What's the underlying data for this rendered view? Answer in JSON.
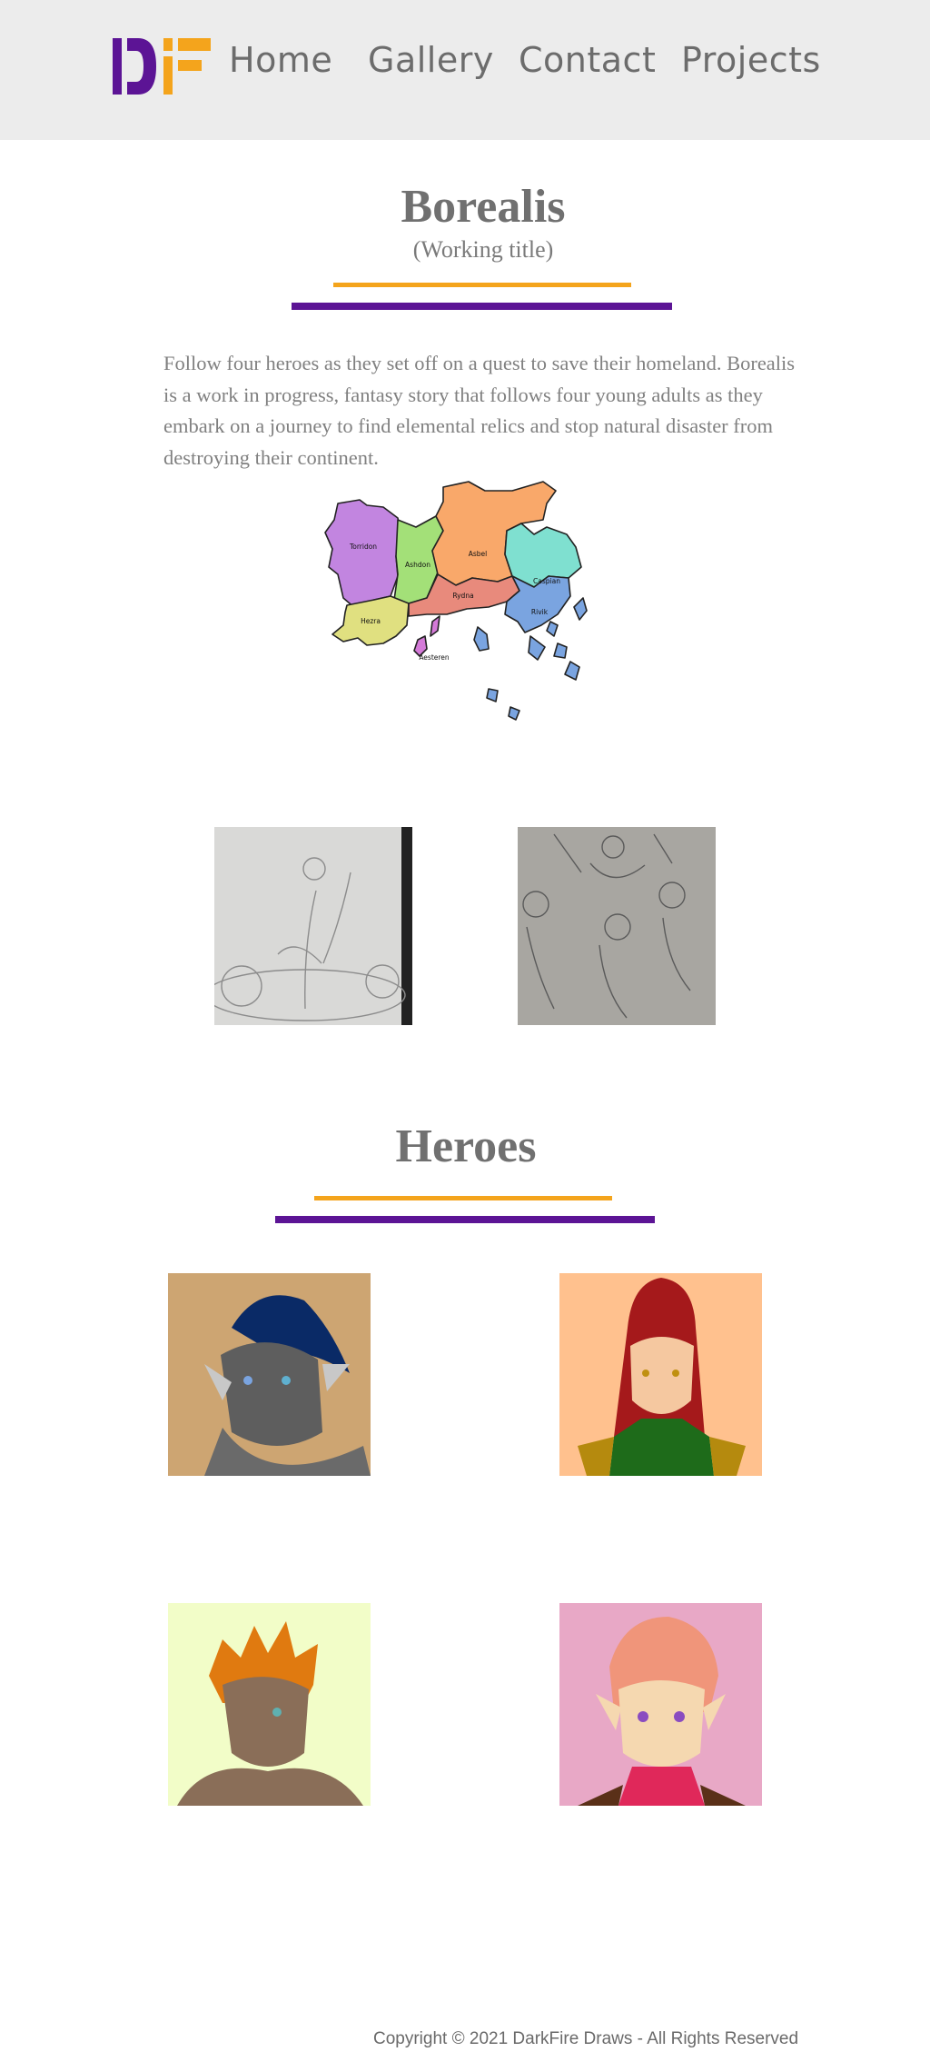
{
  "nav": {
    "logo_text": "DF",
    "items": [
      "Home",
      "Gallery",
      "Contact",
      "Projects"
    ]
  },
  "project": {
    "title": "Borealis",
    "subtitle": "(Working title)",
    "intro": "Follow four heroes as they set off on a quest to save their homeland. Borealis is a work in progress, fantasy story that follows four young adults as they embark on a journey to find elemental relics and stop natural disaster from destroying their continent."
  },
  "map": {
    "regions": [
      "Torridon",
      "Ashdon",
      "Asbel",
      "Caspian",
      "Hezra",
      "Rydna",
      "Rivik",
      "Aesteren"
    ]
  },
  "heroes": {
    "title": "Heroes"
  },
  "footer": {
    "copyright": "Copyright © 2021 DarkFire Draws - All Rights Reserved"
  },
  "colors": {
    "accent_gold": "#f4a41c",
    "accent_purple": "#5c1495",
    "header_bg": "#ececec"
  }
}
